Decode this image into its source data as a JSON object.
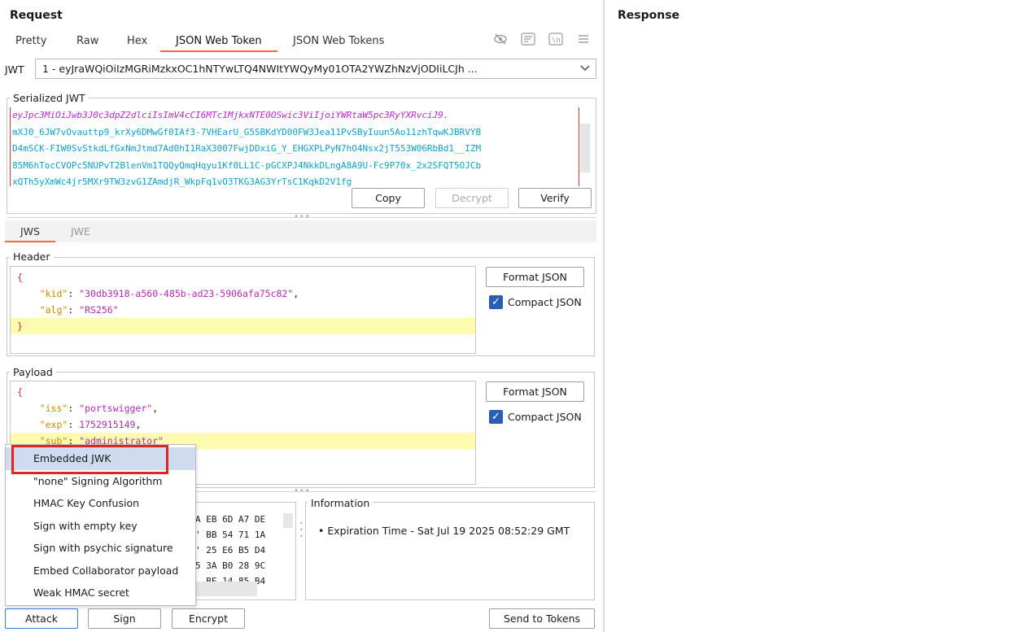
{
  "request": {
    "title": "Request",
    "tabs": [
      "Pretty",
      "Raw",
      "Hex",
      "JSON Web Token",
      "JSON Web Tokens"
    ],
    "active_tab": "JSON Web Token",
    "jwt_label": "JWT",
    "jwt_select_value": "1 - eyJraWQiOiIzMGRiMzkxOC1hNTYwLTQ4NWItYWQyMy01OTA2YWZhNzVjODIiLCJh ...",
    "serialized_label": "Serialized JWT",
    "serialized_lines": [
      {
        "text": "eyJpc3MiOiJwb3J0c3dpZ2dlciIsImV4cCI6MTc1MjkxNTE0OSwic3ViIjoiYWRtaW5pc3RyYXRvciJ9.",
        "color": "#c026d3"
      },
      {
        "text": "mXJ0_6JW7vOvauttp9_krXy6DMwGf0IAf3-7VHEarU_G5SBKdYD00FW3Jea11PvSByIuun5Ao11zhTqwKJBRVYB",
        "color": "#0f9fc9"
      },
      {
        "text": "D4mSCK-FIW0SvStkdLfGxNmJtmd7Ad0hI1RaX3007FwjDDxiG_Y_EHGXPLPyN7hO4Nsx2jT553W06RbBd1__IZM",
        "color": "#0f9fc9"
      },
      {
        "text": "85M6hTocCVOPc5NUPvT2BlenVm1TQQyQmqHqyu1Kf0LL1C-pGCXPJ4NkkDLngA8A9U-Fc9P70x_2x2SFQT5OJCb",
        "color": "#0f9fc9"
      },
      {
        "text": "xQTh5yXmWc4jr5MXr9TW3zvG1ZAmdjR_WkpFq1vO3TKG3AG3YrTsC1KqkD2V1fg",
        "color": "#0f9fc9"
      }
    ],
    "buttons": {
      "copy": "Copy",
      "decrypt": "Decrypt",
      "verify": "Verify"
    },
    "sub_tabs": [
      "JWS",
      "JWE"
    ],
    "header": {
      "label": "Header",
      "lines": [
        [
          {
            "t": "{",
            "c": "brace"
          }
        ],
        [
          {
            "t": "    ",
            "c": "punct"
          },
          {
            "t": "\"kid\"",
            "c": "key"
          },
          {
            "t": ": ",
            "c": "punct"
          },
          {
            "t": "\"30db3918-a560-485b-ad23-5906afa75c82\"",
            "c": "str"
          },
          {
            "t": ",",
            "c": "punct"
          }
        ],
        [
          {
            "t": "    ",
            "c": "punct"
          },
          {
            "t": "\"alg\"",
            "c": "key"
          },
          {
            "t": ": ",
            "c": "punct"
          },
          {
            "t": "\"RS256\"",
            "c": "str"
          }
        ],
        [
          {
            "t": "}",
            "c": "brace"
          }
        ]
      ],
      "highlight_line": 3,
      "format_button": "Format JSON",
      "compact_label": "Compact JSON"
    },
    "payload": {
      "label": "Payload",
      "lines": [
        [
          {
            "t": "{",
            "c": "brace"
          }
        ],
        [
          {
            "t": "    ",
            "c": "punct"
          },
          {
            "t": "\"iss\"",
            "c": "key"
          },
          {
            "t": ": ",
            "c": "punct"
          },
          {
            "t": "\"portswigger\"",
            "c": "str"
          },
          {
            "t": ",",
            "c": "punct"
          }
        ],
        [
          {
            "t": "    ",
            "c": "punct"
          },
          {
            "t": "\"exp\"",
            "c": "key"
          },
          {
            "t": ": ",
            "c": "punct"
          },
          {
            "t": "1752915149",
            "c": "num"
          },
          {
            "t": ",",
            "c": "punct"
          }
        ],
        [
          {
            "t": "    ",
            "c": "punct"
          },
          {
            "t": "\"sub\"",
            "c": "key"
          },
          {
            "t": ": ",
            "c": "punct"
          },
          {
            "t": "\"administrator\"",
            "c": "str"
          }
        ]
      ],
      "highlight_line": 3,
      "format_button": "Format JSON",
      "compact_label": "Compact JSON"
    },
    "hex_lines": [
      "A EB 6D A7 DE",
      "' BB 54 71 1A",
      "' 25 E6 B5 D4",
      "5 3A B0 28 9C",
      "  BE 14 85 B4"
    ],
    "information": {
      "label": "Information",
      "items": [
        "Expiration Time - Sat Jul 19 2025 08:52:29 GMT"
      ]
    },
    "attack_menu": [
      "Embedded JWK",
      "\"none\" Signing Algorithm",
      "HMAC Key Confusion",
      "Sign with empty key",
      "Sign with psychic signature",
      "Embed Collaborator payload",
      "Weak HMAC secret"
    ],
    "bottom_buttons": {
      "attack": "Attack",
      "sign": "Sign",
      "encrypt": "Encrypt",
      "send": "Send to Tokens"
    }
  },
  "response": {
    "title": "Response"
  }
}
